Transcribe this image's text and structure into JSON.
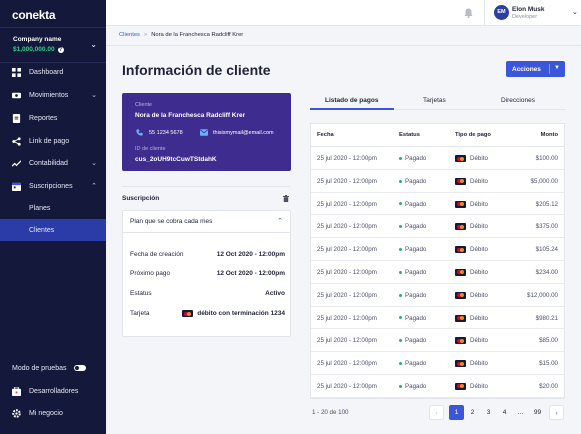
{
  "sidebar": {
    "logo": "conekta",
    "company": {
      "name": "Company name",
      "balance": "$1,000,000.00"
    },
    "items": [
      {
        "label": "Dashboard"
      },
      {
        "label": "Movimientos"
      },
      {
        "label": "Reportes"
      },
      {
        "label": "Link de pago"
      },
      {
        "label": "Contabilidad"
      },
      {
        "label": "Suscripciones"
      }
    ],
    "sub_items": [
      {
        "label": "Planes"
      },
      {
        "label": "Clientes"
      }
    ],
    "test_mode": "Modo de pruebas",
    "developers": "Desarrolladores",
    "my_business": "Mi negocio"
  },
  "topbar": {
    "avatar_initials": "EM",
    "user_name": "Elon Musk",
    "user_role": "Developer"
  },
  "breadcrumb": {
    "parent": "Clientes",
    "current": "Nora de la Franchesca Radcliff Krer"
  },
  "page": {
    "title": "Información de cliente",
    "actions_label": "Acciones"
  },
  "client": {
    "client_label": "Cliente",
    "name": "Nora de la Franchesca Radcliff Krer",
    "phone": "55 1234 5678",
    "email": "thisismymail@email.com",
    "id_label": "ID de cliente",
    "id": "cus_2oUH9tcCuwTStdahK"
  },
  "subscription": {
    "title": "Suscripción",
    "plan": "Plan que se cobra cada mes",
    "fields": [
      {
        "key": "Fecha de creación",
        "value": "12 Oct 2020 - 12:00pm"
      },
      {
        "key": "Próximo pago",
        "value": "12 Oct 2020 - 12:00pm"
      },
      {
        "key": "Estatus",
        "value": "Activo"
      },
      {
        "key": "Tarjeta",
        "value": "débito con terminación 1234"
      }
    ]
  },
  "tabs": [
    {
      "label": "Listado de pagos"
    },
    {
      "label": "Tarjetas"
    },
    {
      "label": "Direcciones"
    }
  ],
  "table": {
    "headers": {
      "date": "Fecha",
      "status": "Estatus",
      "type": "Tipo de pago",
      "amount": "Monto"
    },
    "rows": [
      {
        "date": "25 jul 2020 - 12:00pm",
        "status": "Pagado",
        "type": "Débito",
        "amount": "$100.00"
      },
      {
        "date": "25 jul 2020 - 12:00pm",
        "status": "Pagado",
        "type": "Débito",
        "amount": "$5,000.00"
      },
      {
        "date": "25 jul 2020 - 12:00pm",
        "status": "Pagado",
        "type": "Débito",
        "amount": "$205.12"
      },
      {
        "date": "25 jul 2020 - 12:00pm",
        "status": "Pagado",
        "type": "Débito",
        "amount": "$375.00"
      },
      {
        "date": "25 jul 2020 - 12:00pm",
        "status": "Pagado",
        "type": "Débito",
        "amount": "$105.24"
      },
      {
        "date": "25 jul 2020 - 12:00pm",
        "status": "Pagado",
        "type": "Débito",
        "amount": "$234.00"
      },
      {
        "date": "25 jul 2020 - 12:00pm",
        "status": "Pagado",
        "type": "Débito",
        "amount": "$12,000.00"
      },
      {
        "date": "25 jul 2020 - 12:00pm",
        "status": "Pagado",
        "type": "Débito",
        "amount": "$980.21"
      },
      {
        "date": "25 jul 2020 - 12:00pm",
        "status": "Pagado",
        "type": "Débito",
        "amount": "$85.00"
      },
      {
        "date": "25 jul 2020 - 12:00pm",
        "status": "Pagado",
        "type": "Débito",
        "amount": "$15.00"
      },
      {
        "date": "25 jul 2020 - 12:00pm",
        "status": "Pagado",
        "type": "Débito",
        "amount": "$20.00"
      }
    ]
  },
  "pagination": {
    "info": "1 - 20 de 100",
    "pages": [
      "1",
      "2",
      "3",
      "4",
      "...",
      "99"
    ],
    "current": "1"
  },
  "colors": {
    "sidebar_bg": "#14183a",
    "accent": "#3b56d9",
    "client_card_bg": "#3e2c8e",
    "paid_green": "#27b36a"
  }
}
